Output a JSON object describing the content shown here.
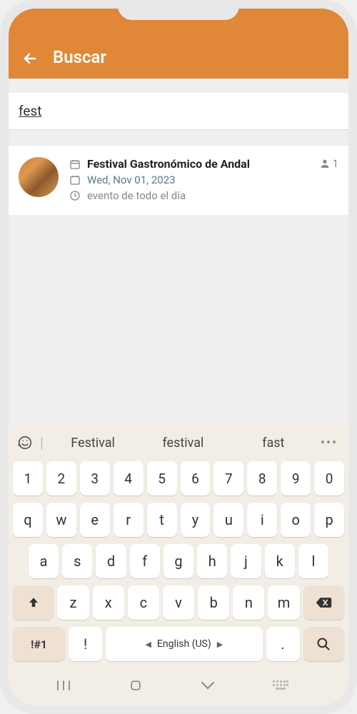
{
  "header": {
    "title": "Buscar"
  },
  "search": {
    "value": "fest"
  },
  "result": {
    "title": "Festival Gastronómico de Andal",
    "date": "Wed, Nov 01, 2023",
    "allday": "evento de todo el día",
    "attendee_count": "1"
  },
  "keyboard": {
    "suggestions": [
      "Festival",
      "festival",
      "fast"
    ],
    "row_num": [
      "1",
      "2",
      "3",
      "4",
      "5",
      "6",
      "7",
      "8",
      "9",
      "0"
    ],
    "row1": [
      "q",
      "w",
      "e",
      "r",
      "t",
      "y",
      "u",
      "i",
      "o",
      "p"
    ],
    "row2": [
      "a",
      "s",
      "d",
      "f",
      "g",
      "h",
      "j",
      "k",
      "l"
    ],
    "row3": [
      "z",
      "x",
      "c",
      "v",
      "b",
      "n",
      "m"
    ],
    "sym_label": "!#1",
    "punct1": "!",
    "space_label": "English (US)",
    "punct2": "."
  }
}
